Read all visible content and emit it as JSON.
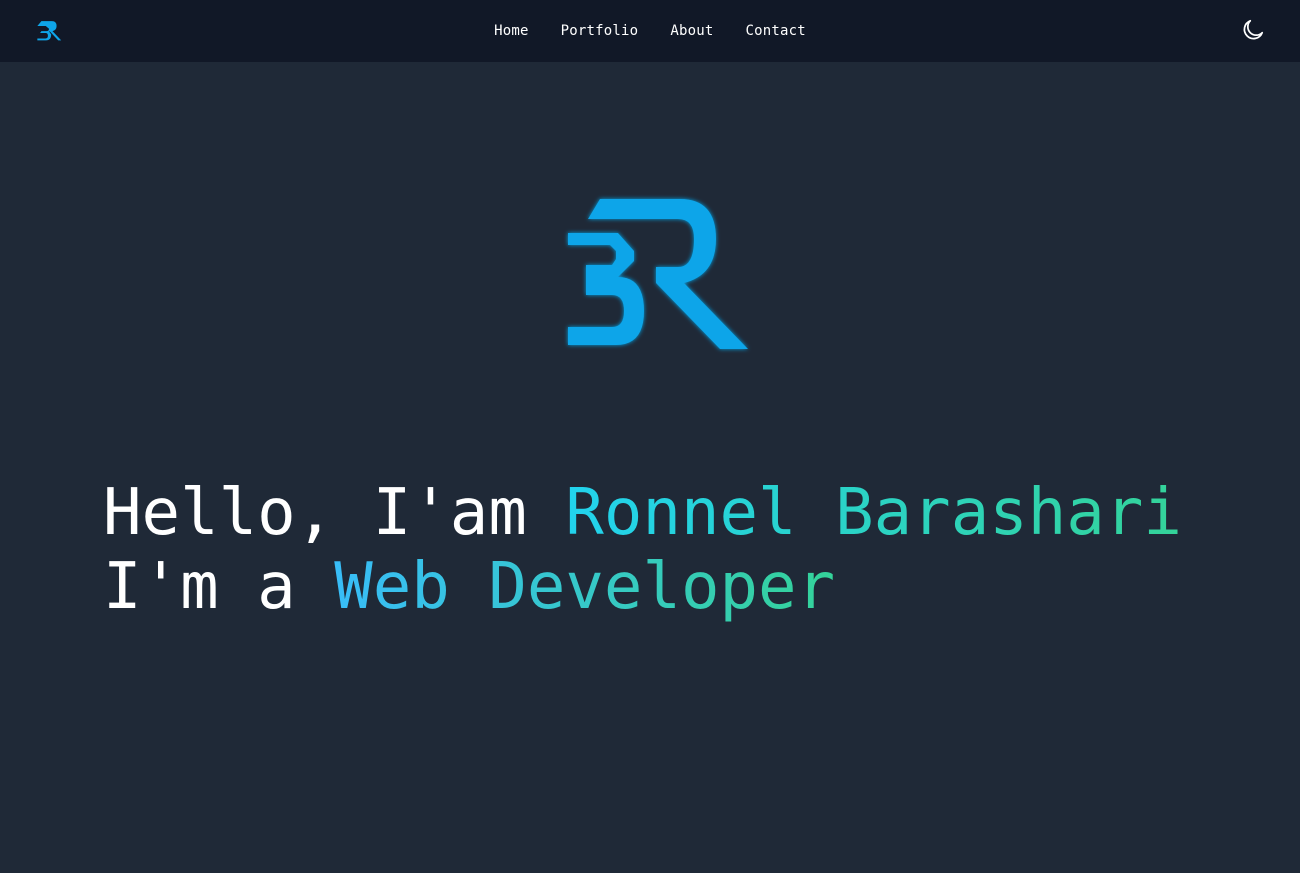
{
  "nav": {
    "logo_icon": "br-logo-icon",
    "links": [
      {
        "label": "Home"
      },
      {
        "label": "Portfolio"
      },
      {
        "label": "About"
      },
      {
        "label": "Contact"
      }
    ],
    "theme_toggle_icon": "moon-icon"
  },
  "hero": {
    "logo_icon": "br-logo-icon",
    "greeting": "Hello, I'am ",
    "name": "Ronnel Barashari",
    "role_prefix": "I'm a ",
    "role": "Web Developer"
  },
  "colors": {
    "background": "#1f2937",
    "navbar": "#111827",
    "logo_blue": "#0ea5e9",
    "gradient_start": "#22d3ee",
    "gradient_end": "#34d399"
  }
}
